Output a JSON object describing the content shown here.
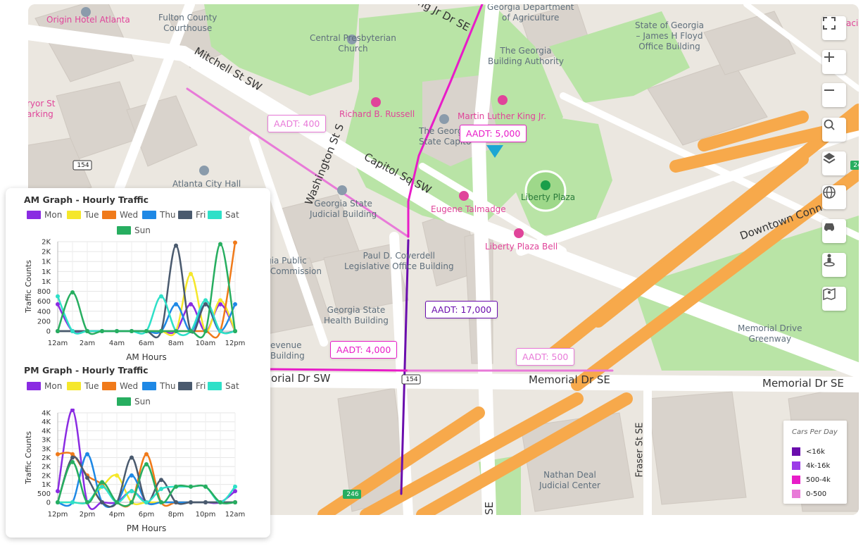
{
  "map": {
    "place_labels": [
      {
        "id": "origin-hotel",
        "text": "Origin Hotel Atlanta",
        "pink": true
      },
      {
        "id": "fulton-courthouse",
        "text": "Fulton County\nCourthouse"
      },
      {
        "id": "central-presbyterian",
        "text": "Central Presbyterian\nChurch"
      },
      {
        "id": "ga-dept-agriculture",
        "text": "Georgia Department\nof Agriculture"
      },
      {
        "id": "ga-building-authority",
        "text": "The Georgia\nBuilding Authority"
      },
      {
        "id": "floyd-building",
        "text": "State of Georgia\n– James H Floyd\nOffice Building"
      },
      {
        "id": "pryor-st",
        "text": "ryor St\narking"
      },
      {
        "id": "richard-russell",
        "text": "Richard B. Russell",
        "pink": true
      },
      {
        "id": "mlk",
        "text": "Martin Luther King Jr.",
        "pink": true
      },
      {
        "id": "ga-state-capitol",
        "text": "The Georgi\nState Capito"
      },
      {
        "id": "atlanta-city-hall",
        "text": "Atlanta City Hall"
      },
      {
        "id": "judicial-building",
        "text": "Georgia State\nJudicial Building"
      },
      {
        "id": "liberty-plaza",
        "text": "Liberty Plaza"
      },
      {
        "id": "eugene-talmadge",
        "text": "Eugene Talmadge",
        "pink": true
      },
      {
        "id": "liberty-plaza-bell",
        "text": "Liberty Plaza Bell",
        "pink": true
      },
      {
        "id": "public-service",
        "text": "orgia Public\nce Commission"
      },
      {
        "id": "coverdell",
        "text": "Paul D. Coverdell\nLegislative Office Building"
      },
      {
        "id": "health-building",
        "text": "Georgia State\nHealth Building"
      },
      {
        "id": "revenue-building",
        "text": "evenue\nBuilding"
      },
      {
        "id": "memorial-greenway",
        "text": "Memorial Drive\nGreenway"
      },
      {
        "id": "nathan-deal",
        "text": "Nathan Deal\nJudicial Center"
      },
      {
        "id": "acia",
        "text": "aci"
      }
    ],
    "street_labels": {
      "mitchell": "Mitchell St SW",
      "washington": "Washington St S",
      "capitol_sq": "Capitol Sq SW",
      "mlk_dr": "ng Jr Dr SE",
      "memorial_sw": "orial Dr SW",
      "memorial_se1": "Memorial Dr SE",
      "memorial_se2": "Memorial Dr SE",
      "fraser": "Fraser St SE",
      "downtown": "Downtown Conne",
      "se_bottom": "SE"
    },
    "shields": {
      "s154a": "154",
      "s154b": "154",
      "s246": "246",
      "s24": "24"
    },
    "aadt_labels": {
      "a400": "AADT: 400",
      "a5000": "AADT: 5,000",
      "a17000": "AADT: 17,000",
      "a4000": "AADT: 4,000",
      "a500": "AADT: 500"
    },
    "legend": {
      "title": "Cars Per Day",
      "items": [
        {
          "label": "<16k",
          "color": "#6a0dad"
        },
        {
          "label": "4k-16k",
          "color": "#9b3be8"
        },
        {
          "label": "500-4k",
          "color": "#e81cc8"
        },
        {
          "label": "0-500",
          "color": "#e87ad8"
        }
      ]
    },
    "controls": [
      "fullscreen-icon",
      "zoom-in-icon",
      "zoom-out-icon",
      "search-icon",
      "layers-icon",
      "globe-icon",
      "car-icon",
      "street-view-icon",
      "map-pin-icon"
    ],
    "colors": {
      "park": "#b7e3a4",
      "building": "#d8d2cc",
      "road": "#ffffff",
      "highway": "#f7a94b",
      "pin": "#1ca6d3"
    }
  },
  "panel": {
    "am_title": "AM Graph - Hourly Traffic",
    "pm_title": "PM Graph - Hourly Traffic",
    "legend": [
      "Mon",
      "Tue",
      "Wed",
      "Thu",
      "Fri",
      "Sat",
      "Sun"
    ]
  },
  "chart_data": [
    {
      "type": "line",
      "title": "AM Graph - Hourly Traffic",
      "xlabel": "AM Hours",
      "ylabel": "Traffic Counts",
      "x": [
        "12am",
        "1am",
        "2am",
        "3am",
        "4am",
        "5am",
        "6am",
        "7am",
        "8am",
        "9am",
        "10am",
        "11am",
        "12pm"
      ],
      "x_tick_labels": [
        "12am",
        "2am",
        "4am",
        "6am",
        "8am",
        "10am",
        "12pm"
      ],
      "y_tick_labels": [
        "0",
        "200",
        "400",
        "600",
        "800",
        "1K",
        "1K",
        "1K",
        "2K",
        "2K"
      ],
      "ylim": [
        0,
        1800
      ],
      "series": [
        {
          "name": "Mon",
          "color": "#8a2be2",
          "values": [
            540,
            0,
            0,
            0,
            0,
            0,
            0,
            0,
            0,
            540,
            0,
            540,
            0
          ]
        },
        {
          "name": "Tue",
          "color": "#f5e72b",
          "values": [
            0,
            0,
            0,
            0,
            0,
            0,
            0,
            0,
            0,
            1150,
            0,
            620,
            0
          ]
        },
        {
          "name": "Wed",
          "color": "#f07a1a",
          "values": [
            0,
            0,
            0,
            0,
            0,
            0,
            0,
            0,
            0,
            0,
            0,
            0,
            1780
          ]
        },
        {
          "name": "Thu",
          "color": "#1e88e5",
          "values": [
            0,
            0,
            0,
            0,
            0,
            0,
            0,
            0,
            540,
            0,
            540,
            0,
            540
          ]
        },
        {
          "name": "Fri",
          "color": "#4a5a6e",
          "values": [
            0,
            0,
            0,
            0,
            0,
            0,
            0,
            0,
            1720,
            0,
            540,
            0,
            0
          ]
        },
        {
          "name": "Sat",
          "color": "#2ee0c8",
          "values": [
            700,
            0,
            0,
            0,
            0,
            0,
            0,
            700,
            0,
            0,
            620,
            0,
            0
          ]
        },
        {
          "name": "Sun",
          "color": "#27ae60",
          "values": [
            0,
            780,
            0,
            0,
            0,
            0,
            0,
            0,
            0,
            0,
            0,
            1750,
            0
          ]
        }
      ]
    },
    {
      "type": "line",
      "title": "PM Graph - Hourly Traffic",
      "xlabel": "PM Hours",
      "ylabel": "Traffic Counts",
      "x": [
        "12pm",
        "1pm",
        "2pm",
        "3pm",
        "4pm",
        "5pm",
        "6pm",
        "7pm",
        "8pm",
        "9pm",
        "10pm",
        "11pm",
        "12am"
      ],
      "x_tick_labels": [
        "12pm",
        "2pm",
        "4pm",
        "6pm",
        "8pm",
        "10pm",
        "12am"
      ],
      "y_tick_labels": [
        "0",
        "500",
        "1K",
        "2K",
        "2K",
        "2K",
        "3K",
        "3K",
        "4K",
        "4K",
        "4K"
      ],
      "ylim": [
        0,
        4000
      ],
      "series": [
        {
          "name": "Mon",
          "color": "#8a2be2",
          "values": [
            500,
            4500,
            0,
            0,
            0,
            500,
            0,
            0,
            0,
            0,
            0,
            0,
            500
          ]
        },
        {
          "name": "Tue",
          "color": "#f5e72b",
          "values": [
            0,
            0,
            0,
            700,
            1200,
            0,
            0,
            0,
            0,
            0,
            0,
            0,
            0
          ]
        },
        {
          "name": "Wed",
          "color": "#f07a1a",
          "values": [
            2150,
            2150,
            1200,
            800,
            0,
            0,
            2150,
            0,
            0,
            0,
            0,
            0,
            0
          ]
        },
        {
          "name": "Thu",
          "color": "#1e88e5",
          "values": [
            0,
            0,
            2150,
            0,
            0,
            1200,
            0,
            0,
            0,
            0,
            0,
            0,
            0
          ]
        },
        {
          "name": "Fri",
          "color": "#4a5a6e",
          "values": [
            0,
            2000,
            1100,
            0,
            0,
            2000,
            0,
            1000,
            0,
            0,
            0,
            0,
            0
          ]
        },
        {
          "name": "Sat",
          "color": "#2ee0c8",
          "values": [
            0,
            0,
            0,
            700,
            0,
            500,
            0,
            600,
            700,
            700,
            700,
            0,
            700
          ]
        },
        {
          "name": "Sun",
          "color": "#27ae60",
          "values": [
            0,
            1800,
            0,
            900,
            0,
            0,
            1700,
            0,
            700,
            700,
            700,
            0,
            0
          ]
        }
      ]
    }
  ]
}
